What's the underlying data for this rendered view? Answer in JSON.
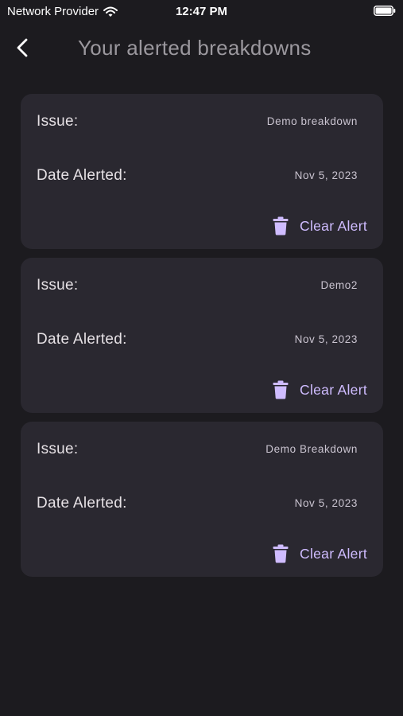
{
  "status_bar": {
    "carrier": "Network Provider",
    "time": "12:47 PM",
    "wifi_icon": "wifi-icon",
    "battery_icon": "battery-icon"
  },
  "app_bar": {
    "title": "Your alerted breakdowns",
    "back_icon": "chevron-left-icon"
  },
  "colors": {
    "background": "#1c1b1f",
    "card": "#2a2830",
    "accent": "#cfbcff"
  },
  "alerts": [
    {
      "issue_label": "Issue:",
      "issue": "Demo breakdown",
      "date_label": "Date Alerted:",
      "date": "Nov 5, 2023",
      "action_label": "Clear Alert",
      "action_icon": "trash-icon"
    },
    {
      "issue_label": "Issue:",
      "issue": "Demo2",
      "date_label": "Date Alerted:",
      "date": "Nov 5, 2023",
      "action_label": "Clear Alert",
      "action_icon": "trash-icon"
    },
    {
      "issue_label": "Issue:",
      "issue": "Demo Breakdown",
      "date_label": "Date Alerted:",
      "date": "Nov 5, 2023",
      "action_label": "Clear Alert",
      "action_icon": "trash-icon"
    }
  ]
}
